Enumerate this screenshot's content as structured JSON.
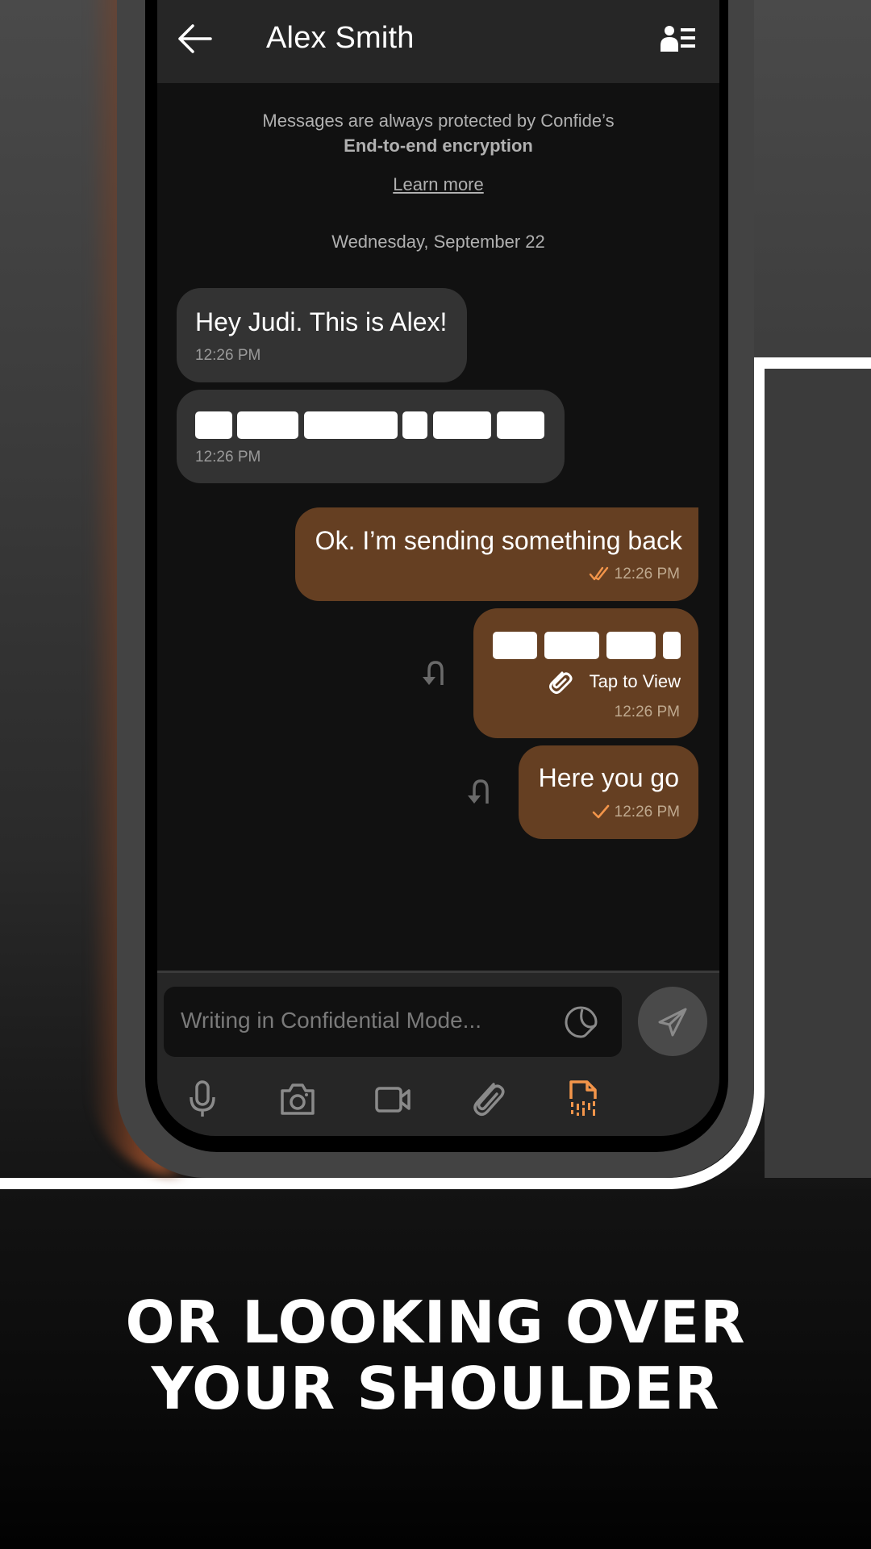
{
  "header": {
    "title": "Alex Smith",
    "back_icon": "arrow-left-icon",
    "contact_icon": "contact-list-icon"
  },
  "encryption_notice": {
    "line1": "Messages are always protected by Confide’s",
    "line2": "End-to-end encryption",
    "link": "Learn more"
  },
  "date_separator": "Wednesday, September 22",
  "messages": [
    {
      "direction": "incoming",
      "text": "Hey Judi. This is Alex!",
      "time": "12:26 PM"
    },
    {
      "direction": "incoming",
      "redacted": true,
      "time": "12:26 PM"
    },
    {
      "direction": "outgoing",
      "text": "Ok. I’m sending something back",
      "time": "12:26 PM",
      "status": "read"
    },
    {
      "direction": "outgoing",
      "redacted": true,
      "attachment_label": "Tap to View",
      "time": "12:26 PM"
    },
    {
      "direction": "outgoing",
      "text": "Here you go",
      "time": "12:26 PM",
      "status": "sent"
    }
  ],
  "composer": {
    "placeholder": "Writing in Confidential Mode...",
    "toolbar": [
      "microphone-icon",
      "camera-icon",
      "video-camera-icon",
      "paperclip-icon",
      "shredded-document-icon"
    ],
    "active_tool": "shredded-document-icon"
  },
  "colors": {
    "accent": "#f3954a",
    "outgoing_bubble": "#653f22",
    "incoming_bubble": "#333333"
  },
  "headline": {
    "line1": "OR LOOKING OVER",
    "line2": "YOUR SHOULDER"
  }
}
